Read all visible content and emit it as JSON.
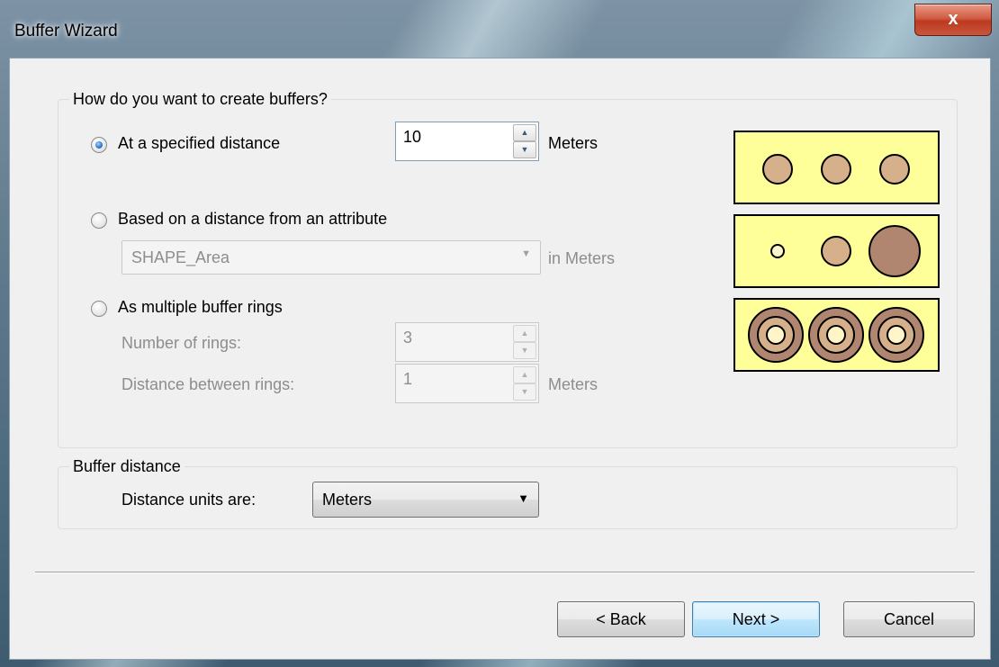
{
  "window": {
    "title": "Buffer Wizard",
    "close_label": "x"
  },
  "create_group": {
    "legend": "How do you want to create buffers?",
    "option_specified": {
      "label": "At a specified distance",
      "value": "10",
      "units": "Meters",
      "selected": true
    },
    "option_attribute": {
      "label": "Based on a distance from an attribute",
      "field_value": "SHAPE_Area",
      "units": "in Meters",
      "selected": false
    },
    "option_rings": {
      "label": "As multiple buffer rings",
      "rings_label": "Number of rings:",
      "rings_value": "3",
      "distance_label": "Distance between rings:",
      "distance_value": "1",
      "distance_units": "Meters",
      "selected": false
    }
  },
  "distance_group": {
    "legend": "Buffer distance",
    "units_label": "Distance units are:",
    "units_value": "Meters"
  },
  "buttons": {
    "back": "< Back",
    "next": "Next >",
    "cancel": "Cancel"
  },
  "preview_colors": {
    "background": "#ffff99",
    "circle_light": "#d6b08a",
    "circle_dark": "#b08670",
    "ring_inner": "#fff5c8"
  }
}
